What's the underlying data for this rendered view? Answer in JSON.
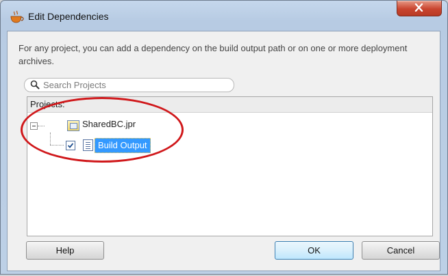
{
  "window": {
    "title": "Edit Dependencies",
    "close_icon": "close-x-icon"
  },
  "description": "For any project, you can add a dependency on the build output path or on one or more deployment archives.",
  "search": {
    "placeholder": "Search Projects",
    "icon": "search-icon"
  },
  "projects_panel": {
    "header": "Projects:",
    "tree": [
      {
        "label": "SharedBC.jpr",
        "icon": "folder-icon",
        "expanded": true,
        "children": [
          {
            "label": "Build Output",
            "checked": true,
            "selected": true,
            "icon": "document-icon"
          }
        ]
      }
    ]
  },
  "buttons": {
    "help": "Help",
    "ok": "OK",
    "cancel": "Cancel"
  },
  "colors": {
    "selection": "#3399ff",
    "annotation": "#d0181b",
    "close": "#c9452f"
  }
}
